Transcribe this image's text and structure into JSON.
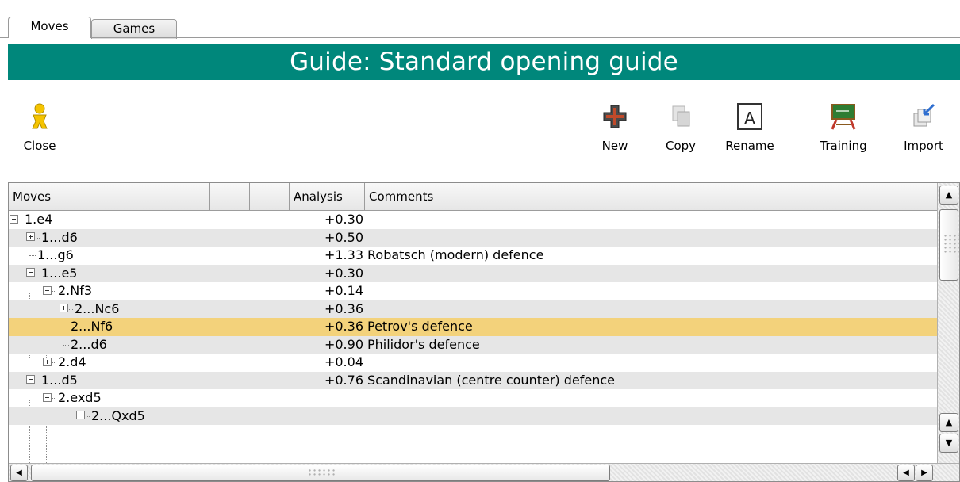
{
  "tabs": [
    {
      "label": "Moves",
      "active": true
    },
    {
      "label": "Games",
      "active": false
    }
  ],
  "header": {
    "title": "Guide: Standard opening guide",
    "bg_color": "#00877b"
  },
  "toolbar": {
    "close": {
      "label": "Close",
      "icon": "close-person-icon"
    },
    "new": {
      "label": "New",
      "icon": "plus-icon"
    },
    "copy": {
      "label": "Copy",
      "icon": "copy-icon"
    },
    "rename": {
      "label": "Rename",
      "icon": "rename-A-icon"
    },
    "training": {
      "label": "Training",
      "icon": "chalkboard-icon"
    },
    "import": {
      "label": "Import",
      "icon": "import-icon"
    }
  },
  "grid": {
    "columns": [
      "Moves",
      "",
      "",
      "Analysis",
      "Comments"
    ],
    "rows": [
      {
        "move": "1.e4",
        "analysis": "+0.30",
        "comment": "",
        "node": "minus"
      },
      {
        "move": "1...d6",
        "analysis": "+0.50",
        "comment": "",
        "node": "plus"
      },
      {
        "move": "1...g6",
        "analysis": "+1.33",
        "comment": "Robatsch (modern) defence",
        "node": "leaf"
      },
      {
        "move": "1...e5",
        "analysis": "+0.30",
        "comment": "",
        "node": "minus"
      },
      {
        "move": "2.Nf3",
        "analysis": "+0.14",
        "comment": "",
        "node": "minus"
      },
      {
        "move": "2...Nc6",
        "analysis": "+0.36",
        "comment": "",
        "node": "plus"
      },
      {
        "move": "2...Nf6",
        "analysis": "+0.36",
        "comment": "Petrov's defence",
        "node": "leaf",
        "selected": true
      },
      {
        "move": "2...d6",
        "analysis": "+0.90",
        "comment": "Philidor's defence",
        "node": "leaf"
      },
      {
        "move": "2.d4",
        "analysis": "+0.04",
        "comment": "",
        "node": "plus"
      },
      {
        "move": "1...d5",
        "analysis": "+0.76",
        "comment": "Scandinavian (centre counter) defence",
        "node": "minus"
      },
      {
        "move": "2.exd5",
        "analysis": "",
        "comment": "",
        "node": "minus"
      },
      {
        "move": "2...Qxd5",
        "analysis": "",
        "comment": "",
        "node": "minus"
      }
    ],
    "selected_color": "#f3d27b"
  }
}
